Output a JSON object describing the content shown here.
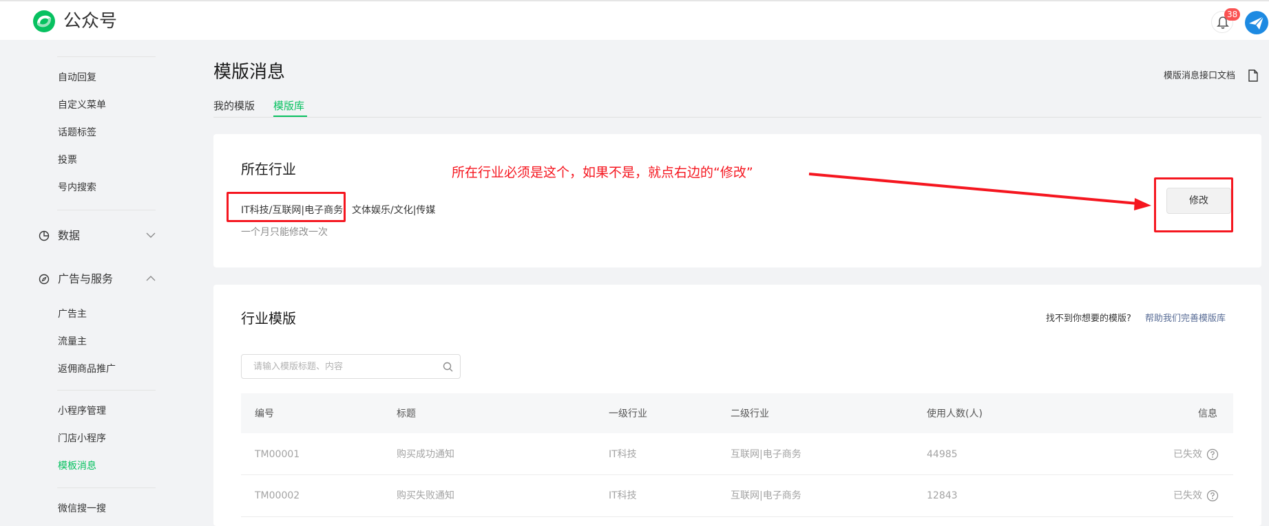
{
  "header": {
    "brand": "公众号",
    "notification_count": "38"
  },
  "sidebar": {
    "items_top": [
      "自动回复",
      "自定义菜单",
      "话题标签",
      "投票",
      "号内搜索"
    ],
    "groups": [
      {
        "label": "数据",
        "icon": "pie-chart-icon",
        "expanded": false
      },
      {
        "label": "广告与服务",
        "icon": "compass-icon",
        "expanded": true
      }
    ],
    "ads_items": [
      "广告主",
      "流量主",
      "返佣商品推广"
    ],
    "mini_items": [
      "小程序管理",
      "门店小程序",
      "模板消息"
    ],
    "bottom_items": [
      "微信搜一搜"
    ],
    "active_item": "模板消息"
  },
  "page": {
    "title": "模版消息",
    "doc_link": "模版消息接口文档",
    "tabs": [
      "我的模版",
      "模版库"
    ],
    "active_tab": "模版库"
  },
  "industry": {
    "title": "所在行业",
    "primary": "IT科技/互联网|电子商务",
    "secondary": "文体娱乐/文化|传媒",
    "note": "一个月只能修改一次",
    "modify_button": "修改",
    "annotation": "所在行业必须是这个，如果不是，就点右边的“修改”"
  },
  "templates": {
    "title": "行业模版",
    "help_question": "找不到你想要的模版?",
    "help_link": "帮助我们完善模版库",
    "search_placeholder": "请输入模版标题、内容",
    "columns": [
      "编号",
      "标题",
      "一级行业",
      "二级行业",
      "使用人数(人)",
      "信息"
    ],
    "rows": [
      {
        "id": "TM00001",
        "title": "购买成功通知",
        "level1": "IT科技",
        "level2": "互联网|电子商务",
        "users": "44985",
        "status": "已失效"
      },
      {
        "id": "TM00002",
        "title": "购买失败通知",
        "level1": "IT科技",
        "level2": "互联网|电子商务",
        "users": "12843",
        "status": "已失效"
      }
    ]
  },
  "colors": {
    "accent": "#07c160",
    "annotation": "#f5161f",
    "link": "#576b95",
    "badge": "#fa5151"
  }
}
